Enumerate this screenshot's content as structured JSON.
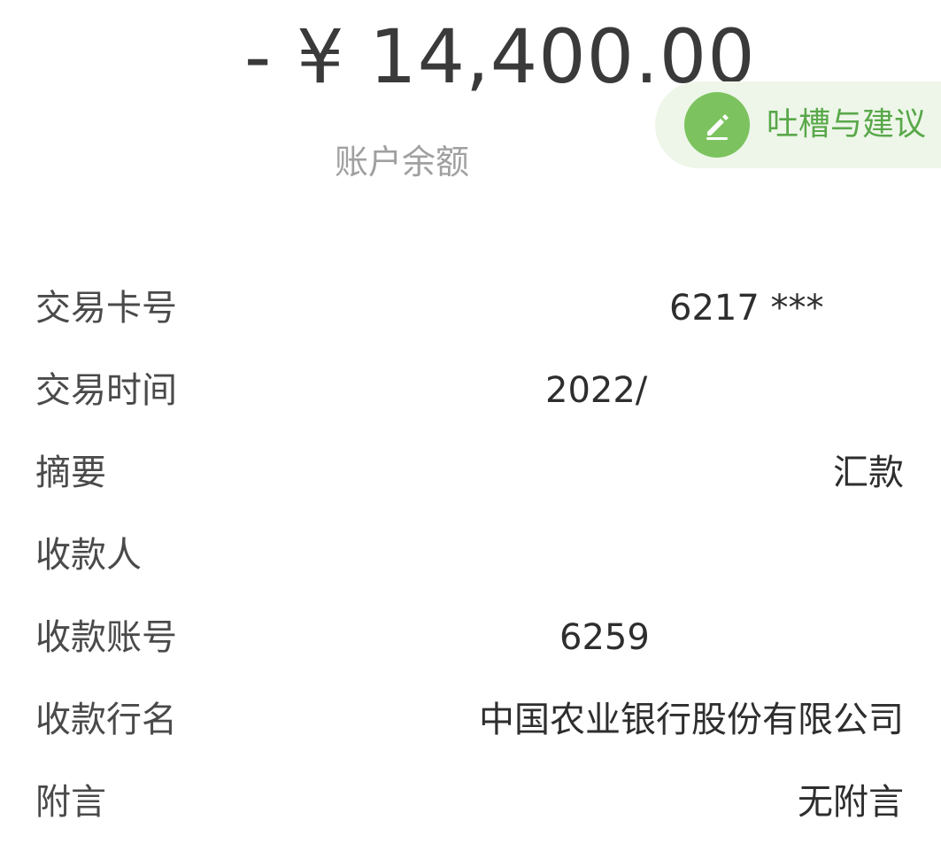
{
  "transaction": {
    "amount": "- ¥ 14,400.00",
    "amount_label": "账户余额"
  },
  "feedback": {
    "icon": "pencil-icon",
    "label": "吐槽与建议",
    "colors": {
      "background": "#eef6e9",
      "icon_circle": "#7cc35f",
      "text": "#59a84a"
    }
  },
  "details": {
    "rows": [
      {
        "label": "交易卡号",
        "value": "6217 ***"
      },
      {
        "label": "交易时间",
        "value": "2022/"
      },
      {
        "label": "摘要",
        "value": "汇款"
      },
      {
        "label": "收款人",
        "value": ""
      },
      {
        "label": "收款账号",
        "value": "6259"
      },
      {
        "label": "收款行名",
        "value": "中国农业银行股份有限公司"
      },
      {
        "label": "附言",
        "value": "无附言"
      }
    ]
  }
}
